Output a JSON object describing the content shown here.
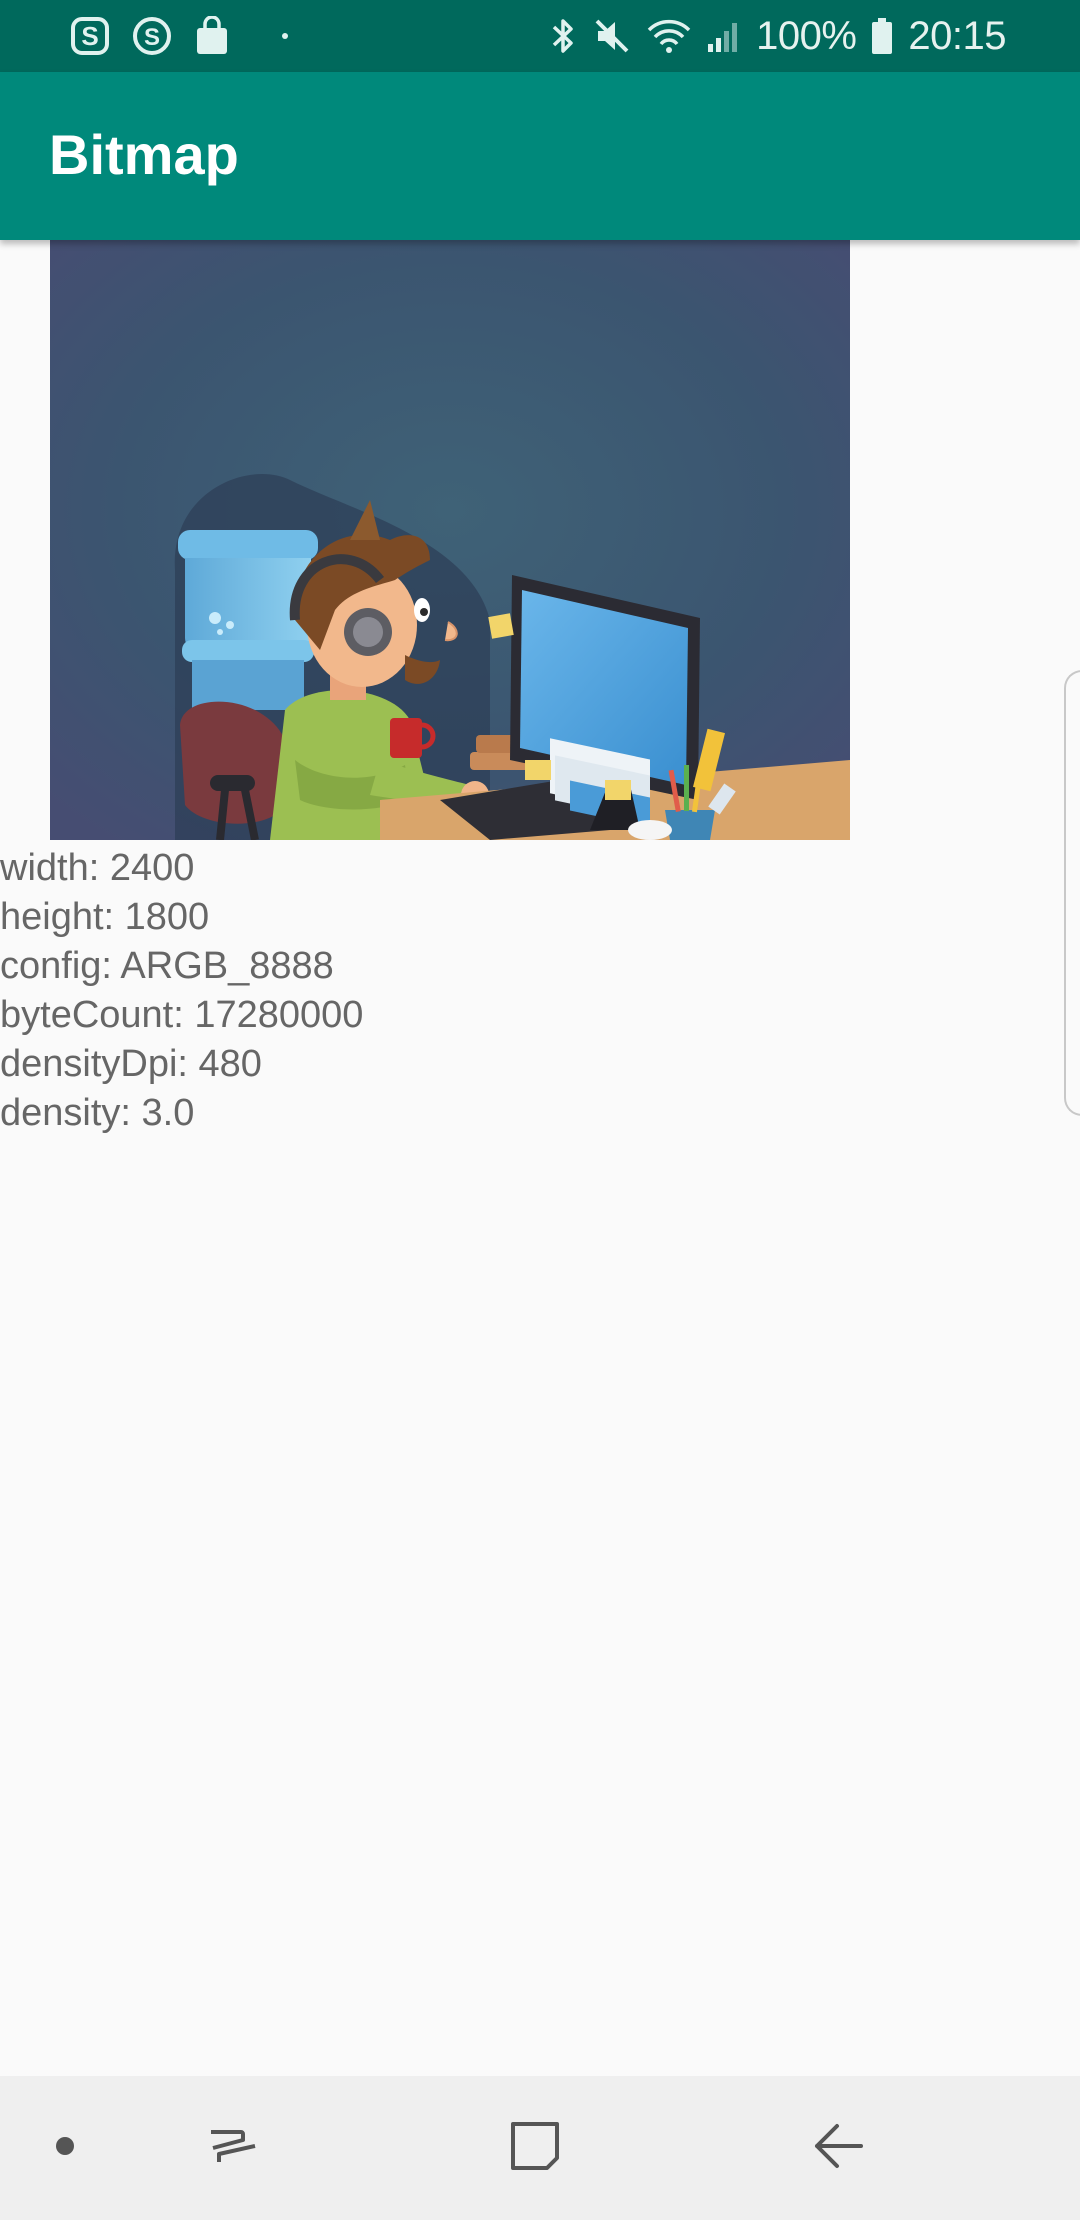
{
  "status_bar": {
    "battery_text": "100%",
    "time": "20:15",
    "left_icons": [
      "s-badge-icon",
      "s-circle-icon",
      "shopping-bag-icon",
      "dot-icon"
    ],
    "right_icons": [
      "bluetooth-icon",
      "mute-icon",
      "wifi-icon",
      "signal-icon",
      "battery-icon"
    ]
  },
  "app_bar": {
    "title": "Bitmap"
  },
  "bitmap_info": {
    "width": "width: 2400",
    "height": "height: 1800",
    "config": "config: ARGB_8888",
    "byte_count": "byteCount: 17280000",
    "density_dpi": "densityDpi: 480",
    "density": "density: 3.0"
  },
  "colors": {
    "status_bar": "#00695c",
    "app_bar": "#00897b",
    "background": "#fafafa",
    "text": "#666666"
  },
  "nav_bar": {
    "items": [
      "nav-dot-icon",
      "recent-apps-icon",
      "home-icon",
      "back-icon"
    ]
  }
}
